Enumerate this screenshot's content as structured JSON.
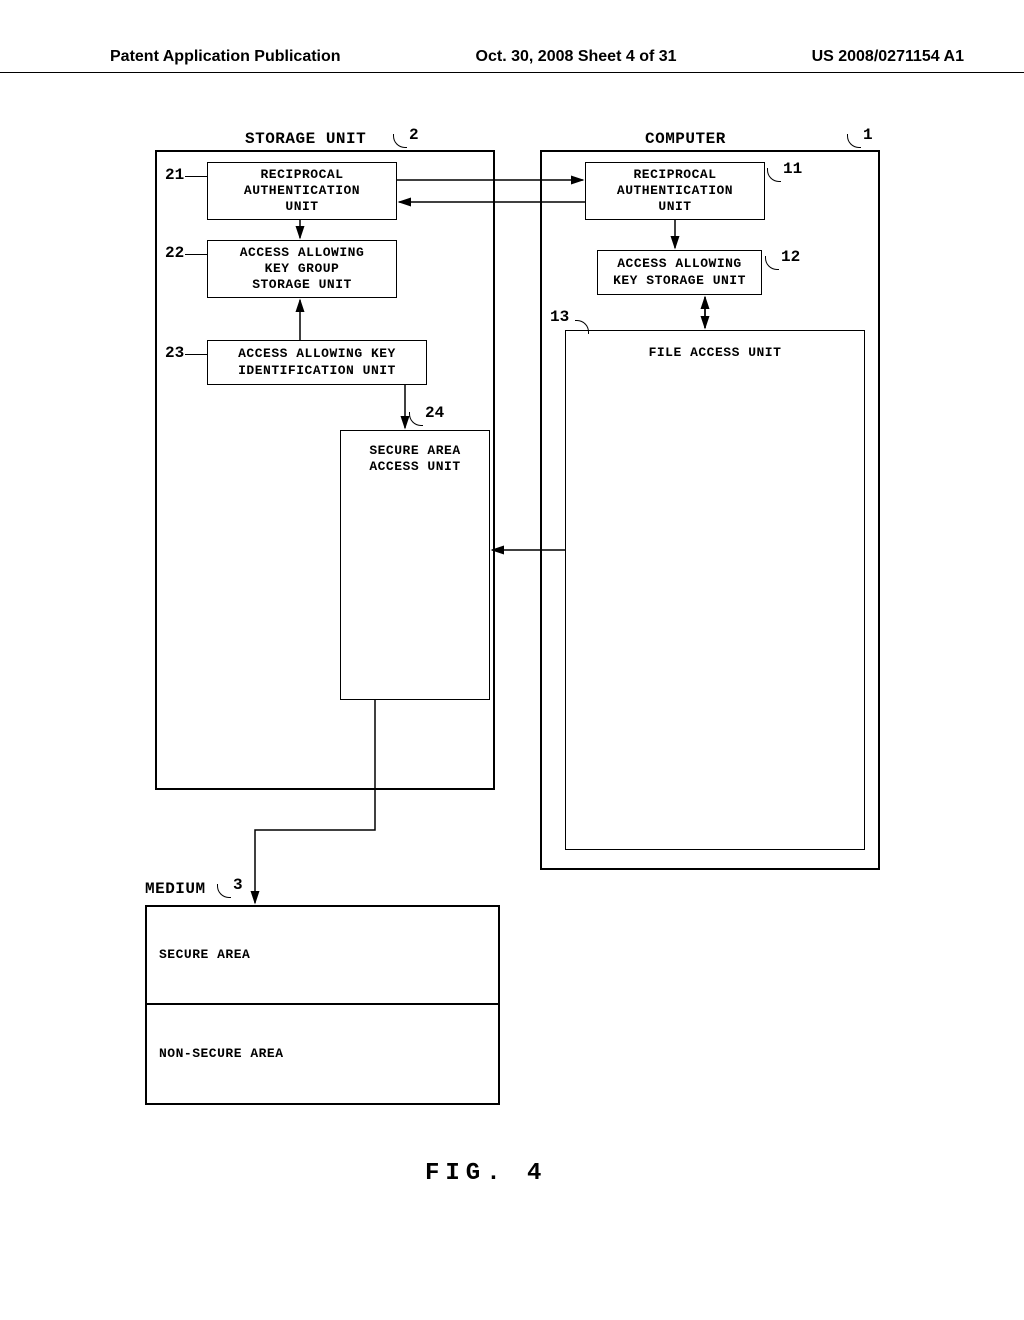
{
  "header": {
    "left": "Patent Application Publication",
    "center": "Oct. 30, 2008  Sheet 4 of 31",
    "right": "US 2008/0271154 A1"
  },
  "diagram": {
    "storage_unit": {
      "title": "STORAGE UNIT",
      "ref": "2"
    },
    "computer": {
      "title": "COMPUTER",
      "ref": "1"
    },
    "blocks": {
      "b21": {
        "ref": "21",
        "label": "RECIPROCAL\nAUTHENTICATION\nUNIT"
      },
      "b22": {
        "ref": "22",
        "label": "ACCESS ALLOWING\nKEY GROUP\nSTORAGE UNIT"
      },
      "b23": {
        "ref": "23",
        "label": "ACCESS ALLOWING KEY\nIDENTIFICATION UNIT"
      },
      "b24": {
        "ref": "24",
        "label": "SECURE AREA\nACCESS UNIT"
      },
      "b11": {
        "ref": "11",
        "label": "RECIPROCAL\nAUTHENTICATION\nUNIT"
      },
      "b12": {
        "ref": "12",
        "label": "ACCESS ALLOWING\nKEY STORAGE UNIT"
      },
      "b13": {
        "ref": "13",
        "label": "FILE ACCESS UNIT"
      }
    },
    "medium": {
      "title": "MEDIUM",
      "ref": "3",
      "secure": "SECURE AREA",
      "nonsecure": "NON-SECURE AREA"
    }
  },
  "figure_caption": "FIG. 4"
}
